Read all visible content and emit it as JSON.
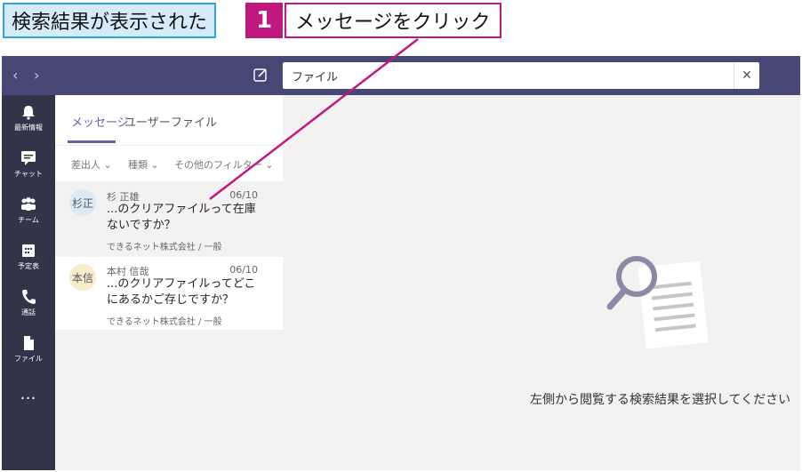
{
  "annotation": {
    "label": "検索結果が表示された",
    "step_number": "1",
    "step_text": "メッセージをクリック"
  },
  "topbar": {
    "back_icon": "chevron-left-icon",
    "forward_icon": "chevron-right-icon",
    "compose_icon": "compose-icon",
    "search_value": "ファイル",
    "clear_icon": "close-icon",
    "color": "#464775"
  },
  "rail": {
    "items": [
      {
        "label": "最新情報",
        "icon": "bell-icon"
      },
      {
        "label": "チャット",
        "icon": "chat-icon"
      },
      {
        "label": "チーム",
        "icon": "teams-icon"
      },
      {
        "label": "予定表",
        "icon": "calendar-icon"
      },
      {
        "label": "通話",
        "icon": "phone-icon"
      },
      {
        "label": "ファイル",
        "icon": "file-icon"
      },
      {
        "label": "…",
        "icon": "more-icon"
      }
    ]
  },
  "search_tabs": [
    "メッセージ",
    "ユーザー",
    "ファイル"
  ],
  "filters": [
    "差出人",
    "種類",
    "その他のフィルター"
  ],
  "results": [
    {
      "avatar": "杉正",
      "name": "杉 正雄",
      "date": "06/10",
      "message": "...のクリアファイルって在庫ないですか？",
      "source": "できるネット株式会社 / 一般"
    },
    {
      "avatar": "本信",
      "name": "本村 信哉",
      "date": "06/10",
      "message": "...のクリアファイルってどこにあるかご存じですか？",
      "source": "できるネット株式会社 / 一般"
    }
  ],
  "detail": {
    "empty_message": "左側から閲覧する検索結果を選択してください"
  },
  "colors": {
    "accent": "#6264a7",
    "annotation_magenta": "#c0187f",
    "annotation_blue": "#2aa7e2"
  }
}
